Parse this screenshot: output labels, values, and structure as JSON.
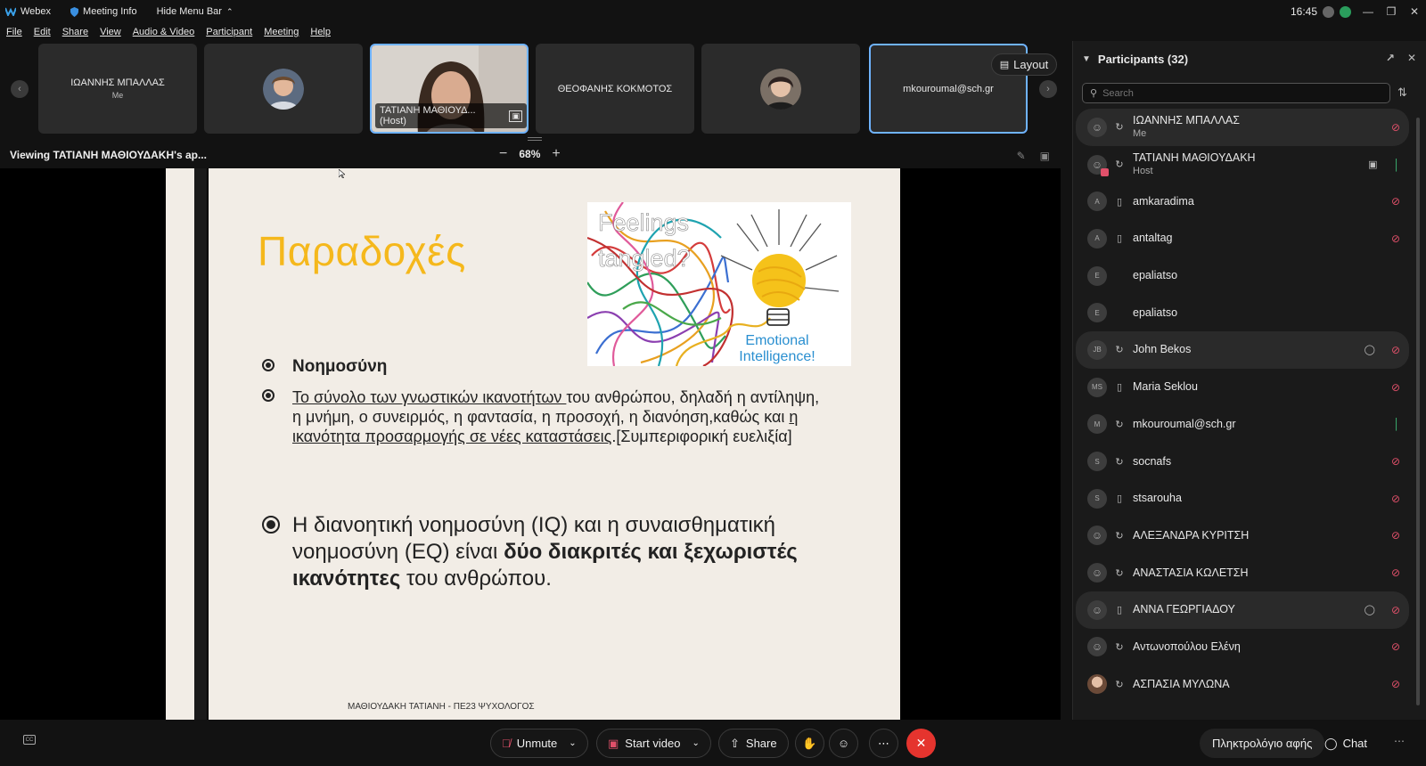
{
  "titlebar": {
    "app_name": "Webex",
    "meeting_info": "Meeting Info",
    "hide_menu": "Hide Menu Bar",
    "time": "16:45"
  },
  "menu": [
    "File",
    "Edit",
    "Share",
    "View",
    "Audio & Video",
    "Participant",
    "Meeting",
    "Help"
  ],
  "filmstrip": {
    "tiles": [
      {
        "name": "ΙΩΑΝΝΗΣ ΜΠΑΛΛΑΣ",
        "sub": "Me"
      },
      {
        "name": "",
        "sub": ""
      },
      {
        "name": "ΤΑΤΙΑΝΗ ΜΑΘΙΟΥΔ... (Host)",
        "sub": ""
      },
      {
        "name": "ΘΕΟΦΑΝΗΣ ΚΟΚΜΟΤΟΣ",
        "sub": ""
      },
      {
        "name": "",
        "sub": ""
      },
      {
        "name": "mkouroumal@sch.gr",
        "sub": ""
      }
    ],
    "layout_label": "Layout"
  },
  "viewbar": {
    "viewing_text": "Viewing ΤΑΤΙΑΝΗ ΜΑΘΙΟΥΔΑΚΗ's ap...",
    "zoom": "68%"
  },
  "slide": {
    "title": "Παραδοχές",
    "bullet1": "Νοημοσύνη",
    "bullet2": {
      "u1": "Το σύνολο των γνωστικών ικανοτήτων ",
      "t1": "του ανθρώπου, δηλαδή η αντίληψη, η μνήμη, ο συνειρμός, η φαντασία, η προσοχή, η διανόηση,καθώς και ",
      "u2": "η ικανότητα προσαρμογής σε νέες καταστάσεις",
      "t2": ".[Συμπεριφορική ευελιξία]"
    },
    "bullet3": {
      "t1": "Η διανοητική νοημοσύνη (IQ) και η συναισθηματική νοημοσύνη (EQ) είναι ",
      "b1": "δύο διακριτές και ξεχωριστές ικανότητες",
      "t2": " του ανθρώπου."
    },
    "image_text": {
      "line1": "Feelings",
      "line2": "tangled?",
      "line3": "Emotional",
      "line4": "Intelligence!"
    },
    "footer": "ΜΑΘΙΟΥΔΑΚΗ ΤΑΤΙΑΝΗ - ΠΕ23 ΨΥΧΟΛΟΓΟΣ"
  },
  "participants": {
    "title": "Participants (32)",
    "search_placeholder": "Search",
    "list": [
      {
        "avatar": "",
        "device": "web",
        "name": "ΙΩΑΝΝΗΣ ΜΠΑΛΛΑΣ",
        "sub": "Me",
        "mic": "off",
        "highlight": true
      },
      {
        "avatar": "",
        "device": "web",
        "name": "ΤΑΤΙΑΝΗ ΜΑΘΙΟΥΔΑΚΗ",
        "sub": "Host",
        "mic": "on",
        "video": true,
        "highlight": false
      },
      {
        "avatar": "A",
        "device": "phone",
        "name": "amkaradima",
        "sub": "",
        "mic": "off",
        "highlight": false
      },
      {
        "avatar": "A",
        "device": "phone",
        "name": "antaltag",
        "sub": "",
        "mic": "off",
        "highlight": false
      },
      {
        "avatar": "E",
        "device": "",
        "name": "epaliatso",
        "sub": "",
        "mic": "",
        "highlight": false
      },
      {
        "avatar": "E",
        "device": "",
        "name": "epaliatso",
        "sub": "",
        "mic": "",
        "highlight": false
      },
      {
        "avatar": "JB",
        "device": "web",
        "name": "John Bekos",
        "sub": "",
        "mic": "off",
        "chat": true,
        "highlight": true
      },
      {
        "avatar": "MS",
        "device": "phone",
        "name": "Maria Seklou",
        "sub": "",
        "mic": "off",
        "highlight": false
      },
      {
        "avatar": "M",
        "device": "web",
        "name": "mkouroumal@sch.gr",
        "sub": "",
        "mic": "on",
        "highlight": false
      },
      {
        "avatar": "S",
        "device": "web",
        "name": "socnafs",
        "sub": "",
        "mic": "off",
        "highlight": false
      },
      {
        "avatar": "S",
        "device": "phone",
        "name": "stsarouha",
        "sub": "",
        "mic": "off",
        "highlight": false
      },
      {
        "avatar": "",
        "device": "web",
        "name": "ΑΛΕΞΑΝΔΡΑ ΚΥΡΙΤΣΗ",
        "sub": "",
        "mic": "off",
        "highlight": false
      },
      {
        "avatar": "",
        "device": "web",
        "name": "ΑΝΑΣΤΑΣΙΑ ΚΩΛΕΤΣΗ",
        "sub": "",
        "mic": "off",
        "highlight": false
      },
      {
        "avatar": "",
        "device": "phone",
        "name": "ΑΝΝΑ ΓΕΩΡΓΙΑΔΟΥ",
        "sub": "",
        "mic": "off",
        "chat": true,
        "highlight": true
      },
      {
        "avatar": "",
        "device": "web",
        "name": "Αντωνοπούλου Ελένη",
        "sub": "",
        "mic": "off",
        "highlight": false
      },
      {
        "avatar": "photo",
        "device": "web",
        "name": "ΑΣΠΑΣΙΑ ΜΥΛΩΝΑ",
        "sub": "",
        "mic": "off",
        "highlight": false
      }
    ]
  },
  "controls": {
    "unmute": "Unmute",
    "start_video": "Start video",
    "share": "Share",
    "keyboard": "Πληκτρολόγιο αφής",
    "chat": "Chat"
  },
  "colors": {
    "accent": "#6fb3ff",
    "end_call": "#e5342e",
    "mic_muted": "#e0506a",
    "mic_active": "#3fc17a",
    "slide_title": "#f5b81c"
  }
}
